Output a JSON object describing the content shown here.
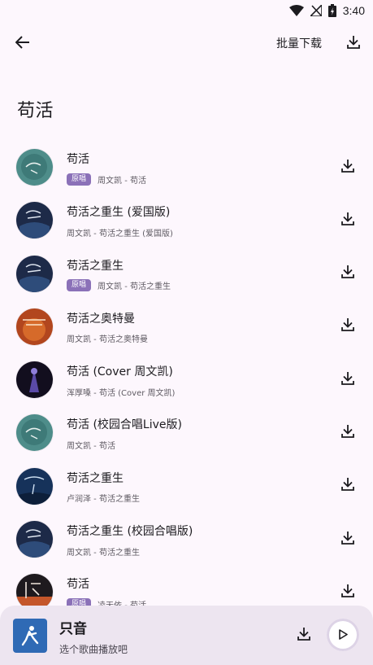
{
  "status": {
    "time": "3:40"
  },
  "appbar": {
    "batch_label": "批量下载"
  },
  "page": {
    "title": "苟活"
  },
  "songs": [
    {
      "title": "苟活",
      "badge": "原唱",
      "subtitle": "周文凯 - 苟活",
      "cover": "teal"
    },
    {
      "title": "苟活之重生 (爱国版)",
      "badge": "",
      "subtitle": "周文凯 - 苟活之重生 (爱国版)",
      "cover": "navy"
    },
    {
      "title": "苟活之重生",
      "badge": "原唱",
      "subtitle": "周文凯 - 苟活之重生",
      "cover": "navy"
    },
    {
      "title": "苟活之奥特曼",
      "badge": "",
      "subtitle": "周文凯 - 苟活之奥特曼",
      "cover": "orange"
    },
    {
      "title": "苟活 (Cover 周文凯)",
      "badge": "",
      "subtitle": "浑厚嗓 - 苟活 (Cover 周文凯)",
      "cover": "purple"
    },
    {
      "title": "苟活 (校园合唱Live版)",
      "badge": "",
      "subtitle": "周文凯 - 苟活",
      "cover": "teal"
    },
    {
      "title": "苟活之重生",
      "badge": "",
      "subtitle": "卢润泽 - 苟活之重生",
      "cover": "deepblue"
    },
    {
      "title": "苟活之重生 (校园合唱版)",
      "badge": "",
      "subtitle": "周文凯 - 苟活之重生",
      "cover": "navy"
    },
    {
      "title": "苟活",
      "badge": "原唱",
      "subtitle": "凌天依 - 苟活",
      "cover": "sunset"
    }
  ],
  "player": {
    "name": "只音",
    "hint": "选个歌曲播放吧"
  },
  "colors": {
    "background": "#fdf7fd",
    "badge": "#8b71b8",
    "player_bar": "#ede5f0",
    "player_art": "#2f6ab5"
  },
  "icons": [
    "wifi-icon",
    "no-signal-icon",
    "battery-charging-icon",
    "back-arrow-icon",
    "download-icon",
    "play-icon",
    "app-logo-icon"
  ]
}
